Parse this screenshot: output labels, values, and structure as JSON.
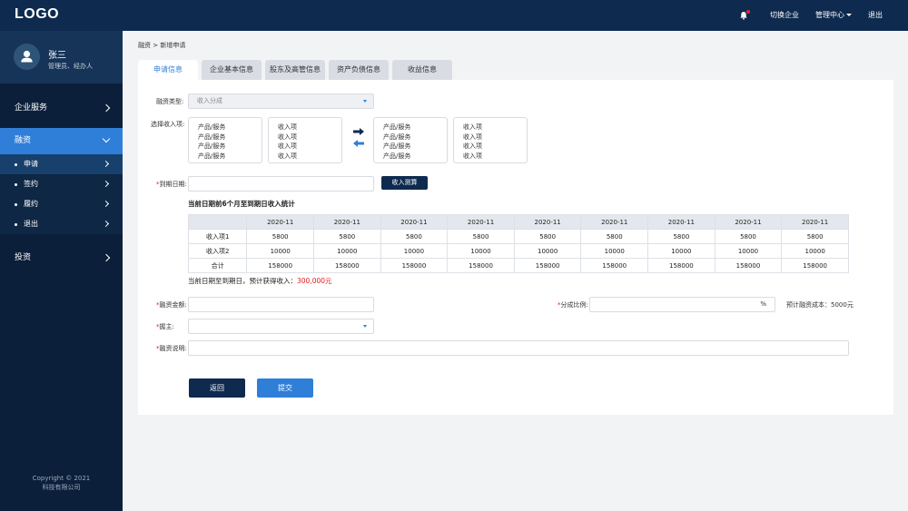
{
  "topbar": {
    "logo": "LOGO",
    "switch_company": "切换企业",
    "admin_center": "管理中心",
    "logout": "退出"
  },
  "user": {
    "name": "张三",
    "role": "管理员、经办人"
  },
  "sidebar": {
    "items": [
      {
        "label": "企业服务"
      },
      {
        "label": "融资"
      },
      {
        "label": "投资"
      }
    ],
    "sub_items": [
      {
        "label": "申请"
      },
      {
        "label": "签约"
      },
      {
        "label": "履约"
      },
      {
        "label": "退出"
      }
    ],
    "copyright_line1": "Copyright © 2021",
    "copyright_line2": "科技有限公司"
  },
  "breadcrumb": "融资 > 新增申请",
  "tabs": [
    {
      "label": "申请信息"
    },
    {
      "label": "企业基本信息"
    },
    {
      "label": "股东及高管信息"
    },
    {
      "label": "资产负债信息"
    },
    {
      "label": "收益信息"
    }
  ],
  "form": {
    "financing_type_label": "融资类型:",
    "financing_type_value": "收入分成",
    "income_items_label": "选择收入项:",
    "left_list_a": [
      "产品/服务",
      "产品/服务",
      "产品/服务",
      "产品/服务"
    ],
    "left_list_b": [
      "收入项",
      "收入项",
      "收入项",
      "收入项"
    ],
    "right_list_a": [
      "产品/服务",
      "产品/服务",
      "产品/服务",
      "产品/服务"
    ],
    "right_list_b": [
      "收入项",
      "收入项",
      "收入项",
      "收入项"
    ],
    "maturity_label": "到期日期:",
    "calc_button": "收入测算",
    "amount_label": "融资金额:",
    "share_ratio_label": "分成比例:",
    "share_ratio_unit": "%",
    "expected_cost": "预计融资成本：5000元",
    "guarantor_label": "握主:",
    "description_label": "融资说明:",
    "back_button": "返回",
    "submit_button": "提交"
  },
  "stats": {
    "title": "当前日期前6个月至到期日收入统计",
    "headers": [
      "",
      "2020-11",
      "2020-11",
      "2020-11",
      "2020-11",
      "2020-11",
      "2020-11",
      "2020-11",
      "2020-11",
      "2020-11"
    ],
    "rows": [
      [
        "收入项1",
        "5800",
        "5800",
        "5800",
        "5800",
        "5800",
        "5800",
        "5800",
        "5800",
        "5800"
      ],
      [
        "收入项2",
        "10000",
        "10000",
        "10000",
        "10000",
        "10000",
        "10000",
        "10000",
        "10000",
        "10000"
      ],
      [
        "合计",
        "158000",
        "158000",
        "158000",
        "158000",
        "158000",
        "158000",
        "158000",
        "158000",
        "158000"
      ]
    ],
    "estimate_prefix": "当前日期至到期日，预计获得收入：",
    "estimate_value": "300,000元"
  },
  "colors": {
    "topbar": "#0e2a4f",
    "sidebar": "#0b1f3a",
    "accent": "#2f7fd9",
    "required": "#e02020"
  }
}
